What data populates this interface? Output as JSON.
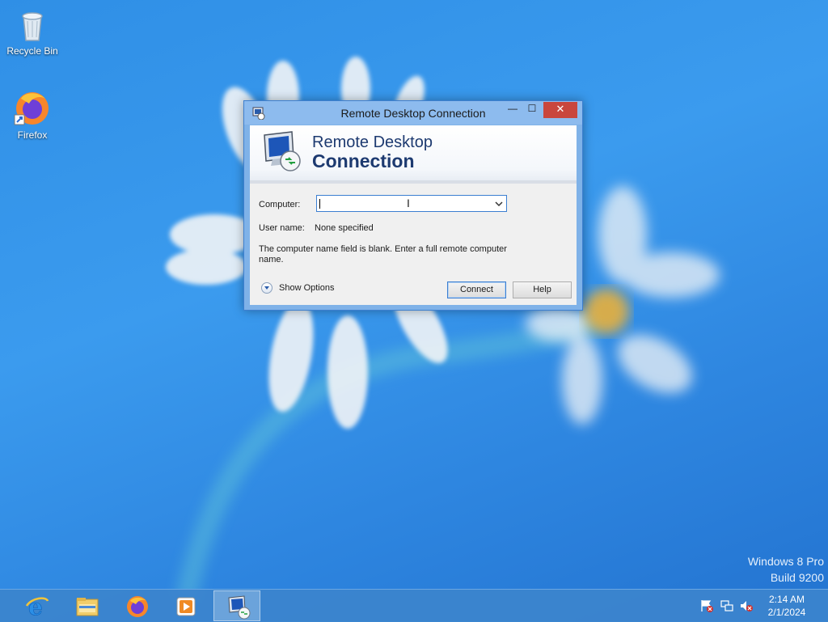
{
  "desktop": {
    "icons": [
      {
        "label": "Recycle Bin",
        "icon": "recycle-bin-icon"
      },
      {
        "label": "Firefox",
        "icon": "firefox-icon"
      }
    ],
    "watermark": {
      "line1": "Windows 8 Pro",
      "line2": "Build 9200"
    }
  },
  "dialog": {
    "title": "Remote Desktop Connection",
    "banner_line1": "Remote Desktop",
    "banner_line2": "Connection",
    "computer_label": "Computer:",
    "computer_value": "",
    "user_label": "User name:",
    "user_value": "None specified",
    "message": "The computer name field is blank. Enter a full remote computer name.",
    "show_options": "Show Options",
    "connect_label": "Connect",
    "help_label": "Help",
    "close_glyph": "✕",
    "min_glyph": "—",
    "max_glyph": "☐"
  },
  "taskbar": {
    "pinned": [
      "internet-explorer-icon",
      "file-explorer-icon",
      "firefox-icon",
      "media-player-icon",
      "remote-desktop-icon"
    ],
    "tray": [
      "action-center-flag-icon",
      "network-icon",
      "volume-muted-icon"
    ],
    "clock_time": "2:14 AM",
    "clock_date": "2/1/2024"
  },
  "colors": {
    "desktop_bg": "#2f8fe6",
    "title_bar": "#8dbbee",
    "close_button": "#c9463d",
    "focus_border": "#3c7fd1"
  }
}
